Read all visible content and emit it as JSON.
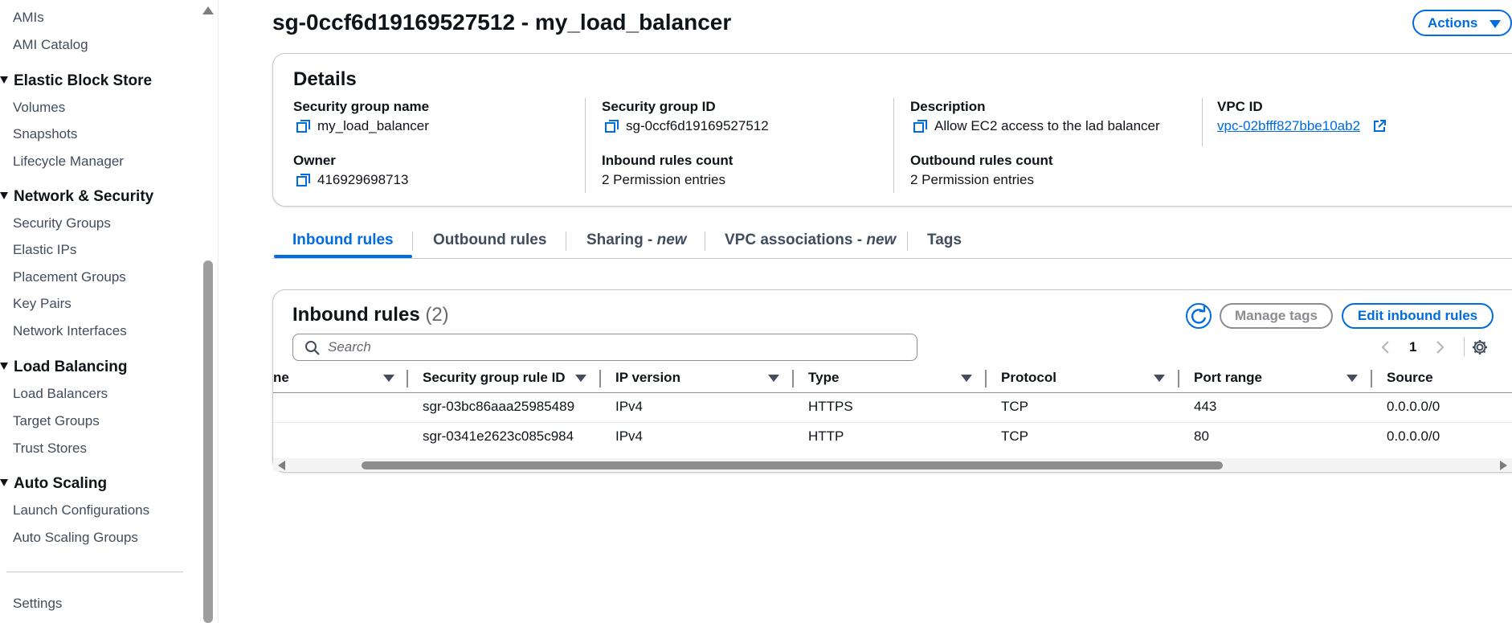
{
  "sidebar": {
    "items": [
      {
        "label": "AMIs",
        "type": "item"
      },
      {
        "label": "AMI Catalog",
        "type": "item"
      },
      {
        "label": "Elastic Block Store",
        "type": "section"
      },
      {
        "label": "Volumes",
        "type": "item"
      },
      {
        "label": "Snapshots",
        "type": "item"
      },
      {
        "label": "Lifecycle Manager",
        "type": "item"
      },
      {
        "label": "Network & Security",
        "type": "section"
      },
      {
        "label": "Security Groups",
        "type": "item"
      },
      {
        "label": "Elastic IPs",
        "type": "item"
      },
      {
        "label": "Placement Groups",
        "type": "item"
      },
      {
        "label": "Key Pairs",
        "type": "item"
      },
      {
        "label": "Network Interfaces",
        "type": "item"
      },
      {
        "label": "Load Balancing",
        "type": "section"
      },
      {
        "label": "Load Balancers",
        "type": "item"
      },
      {
        "label": "Target Groups",
        "type": "item"
      },
      {
        "label": "Trust Stores",
        "type": "item"
      },
      {
        "label": "Auto Scaling",
        "type": "section"
      },
      {
        "label": "Launch Configurations",
        "type": "item"
      },
      {
        "label": "Auto Scaling Groups",
        "type": "item"
      },
      {
        "label": "Settings",
        "type": "item"
      }
    ]
  },
  "header": {
    "title": "sg-0ccf6d19169527512 - my_load_balancer",
    "actions_label": "Actions"
  },
  "details": {
    "title": "Details",
    "sg_name_label": "Security group name",
    "sg_name_value": "my_load_balancer",
    "sg_id_label": "Security group ID",
    "sg_id_value": "sg-0ccf6d19169527512",
    "description_label": "Description",
    "description_value": "Allow EC2 access to the lad balancer",
    "vpc_label": "VPC ID",
    "vpc_value": "vpc-02bfff827bbe10ab2",
    "owner_label": "Owner",
    "owner_value": "416929698713",
    "inbound_count_label": "Inbound rules count",
    "inbound_count_value": "2 Permission entries",
    "outbound_count_label": "Outbound rules count",
    "outbound_count_value": "2 Permission entries"
  },
  "tabs": [
    {
      "label": "Inbound rules",
      "suffix": ""
    },
    {
      "label": "Outbound rules",
      "suffix": ""
    },
    {
      "label": "Sharing - ",
      "suffix": "new"
    },
    {
      "label": "VPC associations - ",
      "suffix": "new"
    },
    {
      "label": "Tags",
      "suffix": ""
    }
  ],
  "rules": {
    "title": "Inbound rules",
    "count": "(2)",
    "manage_tags_label": "Manage tags",
    "edit_label": "Edit inbound rules",
    "search_placeholder": "Search",
    "page": "1",
    "columns": [
      "ne",
      "Security group rule ID",
      "IP version",
      "Type",
      "Protocol",
      "Port range",
      "Source"
    ],
    "rows": [
      {
        "rule_id": "sgr-03bc86aaa25985489",
        "ip_version": "IPv4",
        "type": "HTTPS",
        "protocol": "TCP",
        "port_range": "443",
        "source": "0.0.0.0/0"
      },
      {
        "rule_id": "sgr-0341e2623c085c984",
        "ip_version": "IPv4",
        "type": "HTTP",
        "protocol": "TCP",
        "port_range": "80",
        "source": "0.0.0.0/0"
      }
    ]
  },
  "colors": {
    "accent": "#006ce0",
    "text": "#0f141a",
    "muted": "#414d5c",
    "border": "#c6c6cd"
  }
}
